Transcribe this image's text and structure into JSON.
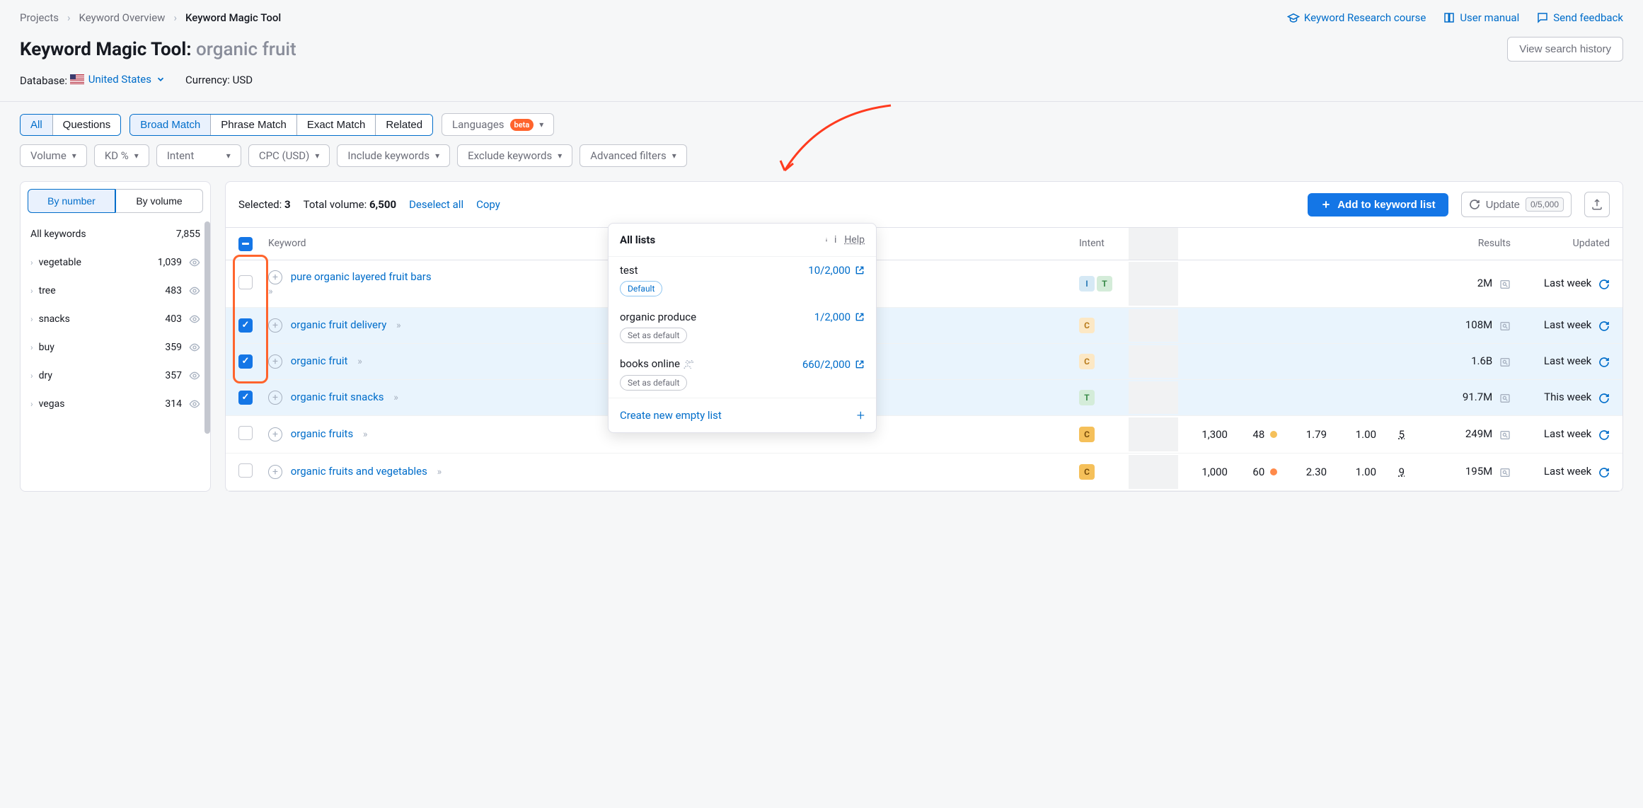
{
  "breadcrumb": {
    "projects": "Projects",
    "overview": "Keyword Overview",
    "current": "Keyword Magic Tool"
  },
  "header_links": {
    "research": "Keyword Research course",
    "manual": "User manual",
    "feedback": "Send feedback"
  },
  "title": {
    "prefix": "Keyword Magic Tool:",
    "query": "organic fruit",
    "view_history": "View search history"
  },
  "meta": {
    "database_label": "Database:",
    "database_value": "United States",
    "currency_label": "Currency:",
    "currency_value": "USD"
  },
  "mode_tabs": {
    "all": "All",
    "questions": "Questions"
  },
  "match_tabs": {
    "broad": "Broad Match",
    "phrase": "Phrase Match",
    "exact": "Exact Match",
    "related": "Related"
  },
  "lang_pill": {
    "label": "Languages",
    "beta": "beta"
  },
  "filter_pills": {
    "volume": "Volume",
    "kd": "KD %",
    "intent": "Intent",
    "cpc": "CPC (USD)",
    "include": "Include keywords",
    "exclude": "Exclude keywords",
    "advanced": "Advanced filters"
  },
  "sidebar": {
    "tab1": "By number",
    "tab2": "By volume",
    "all_label": "All keywords",
    "all_count": "7,855",
    "items": [
      {
        "label": "vegetable",
        "count": "1,039"
      },
      {
        "label": "tree",
        "count": "483"
      },
      {
        "label": "snacks",
        "count": "403"
      },
      {
        "label": "buy",
        "count": "359"
      },
      {
        "label": "dry",
        "count": "357"
      },
      {
        "label": "vegas",
        "count": "314"
      }
    ]
  },
  "panel": {
    "selected_label": "Selected:",
    "selected_count": "3",
    "total_label": "Total volume:",
    "total_value": "6,500",
    "deselect": "Deselect all",
    "copy": "Copy",
    "add_btn": "Add to keyword list",
    "update": "Update",
    "update_badge": "0/5,000"
  },
  "columns": {
    "keyword": "Keyword",
    "intent": "Intent",
    "results": "Results",
    "updated": "Updated"
  },
  "rows": [
    {
      "checked": false,
      "keyword": "pure organic layered fruit bars",
      "intent": [
        "I",
        "T"
      ],
      "vol": "",
      "kd": "",
      "cpc": "",
      "den": "",
      "sf": "",
      "results": "2M",
      "updated": "Last week",
      "multiline": true
    },
    {
      "checked": true,
      "keyword": "organic fruit delivery",
      "intent": [
        "C"
      ],
      "vol": "",
      "kd": "",
      "cpc": "",
      "den": "",
      "sf": "",
      "results": "108M",
      "updated": "Last week"
    },
    {
      "checked": true,
      "keyword": "organic fruit",
      "intent": [
        "C"
      ],
      "vol": "",
      "kd": "",
      "cpc": "",
      "den": "",
      "sf": "",
      "results": "1.6B",
      "updated": "Last week"
    },
    {
      "checked": true,
      "keyword": "organic fruit snacks",
      "intent": [
        "T"
      ],
      "vol": "",
      "kd": "",
      "cpc": "",
      "den": "",
      "sf": "",
      "results": "91.7M",
      "updated": "This week"
    },
    {
      "checked": false,
      "keyword": "organic fruits",
      "intent": [
        "C-dark"
      ],
      "vol": "1,300",
      "kd": "48",
      "kd_dot": "y",
      "cpc": "1.79",
      "den": "1.00",
      "sf": "5",
      "results": "249M",
      "updated": "Last week"
    },
    {
      "checked": false,
      "keyword": "organic fruits and vegetables",
      "intent": [
        "C-dark"
      ],
      "vol": "1,000",
      "kd": "60",
      "kd_dot": "o",
      "cpc": "2.30",
      "den": "1.00",
      "sf": "9",
      "results": "195M",
      "updated": "Last week"
    }
  ],
  "popover": {
    "title": "All lists",
    "help": "Help",
    "items": [
      {
        "name": "test",
        "count": "10/2,000",
        "badge": "Default",
        "default": true
      },
      {
        "name": "organic produce",
        "count": "1/2,000",
        "badge": "Set as default",
        "default": false
      },
      {
        "name": "books online",
        "count": "660/2,000",
        "badge": "Set as default",
        "default": false,
        "shared": true
      }
    ],
    "create": "Create new empty list"
  }
}
